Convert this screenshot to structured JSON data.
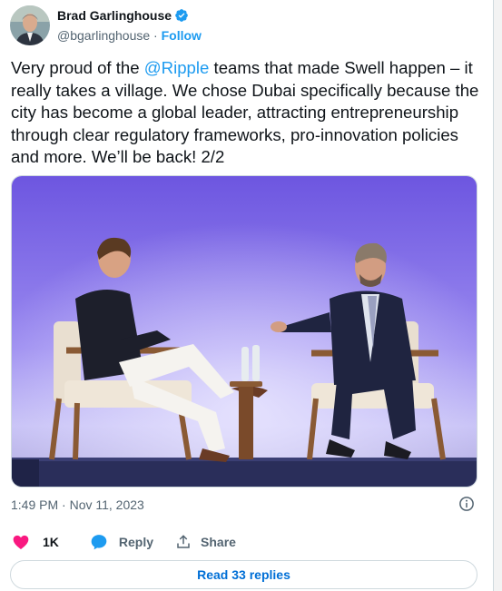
{
  "author": {
    "name": "Brad Garlinghouse",
    "handle": "@bgarlinghouse",
    "separator": " · ",
    "follow_label": "Follow",
    "verified": true
  },
  "tweet": {
    "text_before": "Very proud of the ",
    "mention": "@Ripple",
    "text_after": " teams that made Swell happen – it really takes a village. We chose Dubai specifically because the city has become a global leader, attracting entrepreneurship through clear regulatory frameworks, pro-innovation policies and more. We’ll be back! 2/2"
  },
  "timestamp": "1:49 PM · Nov 11, 2023",
  "actions": {
    "like_count": "1K",
    "reply_label": "Reply",
    "share_label": "Share"
  },
  "read_replies_label": "Read 33 replies",
  "colors": {
    "link": "#1d9bf0",
    "like": "#f91880",
    "reply": "#1d9bf0",
    "secondary_text": "#536471",
    "replies_link": "#006fd6"
  }
}
